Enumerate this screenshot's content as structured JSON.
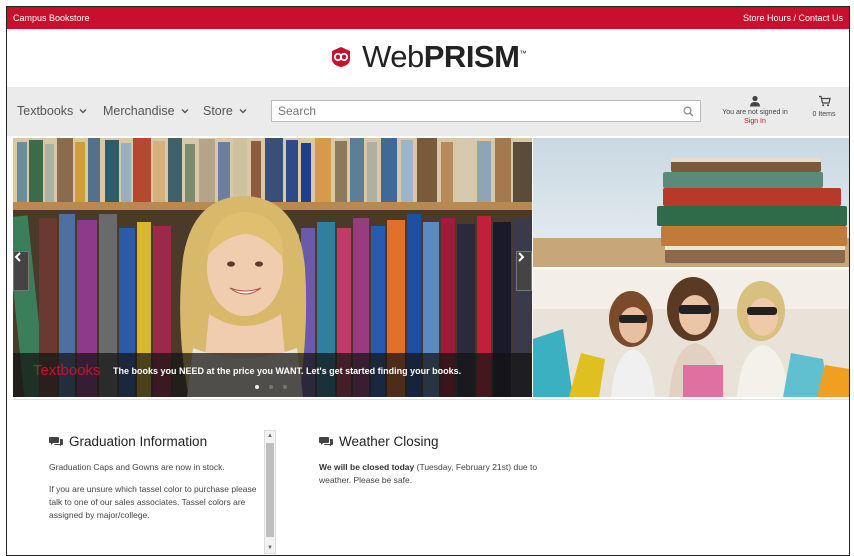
{
  "topbar": {
    "left_link": "Campus Bookstore",
    "right_link": "Store Hours / Contact Us",
    "bg_color": "#c8102e"
  },
  "brand": {
    "logo_web": "Web",
    "logo_prism": "PRISM",
    "trademark": "™",
    "icon": "prism-logo-icon"
  },
  "nav": {
    "items": [
      {
        "label": "Textbooks",
        "icon": "chevron-down-icon"
      },
      {
        "label": "Merchandise",
        "icon": "chevron-down-icon"
      },
      {
        "label": "Store",
        "icon": "chevron-down-icon"
      }
    ],
    "search_placeholder": "Search",
    "account_status": "You are not signed in",
    "sign_in": "Sign In",
    "cart_count": "0 Items"
  },
  "hero": {
    "title": "Textbooks",
    "text": "The books you NEED at the price you WANT. Let's get started finding your books.",
    "slide_count": 3,
    "active_slide": 1
  },
  "news": [
    {
      "title": "Graduation Information",
      "paragraphs": [
        "Graduation Caps and Gowns are now in stock.",
        "If you are unsure which tassel color to purchase please talk to one of our sales associates.  Tassel colors are assigned by major/college."
      ]
    },
    {
      "title": "Weather Closing",
      "bold": "We will be closed today",
      "text": " (Tuesday, February 21st) due to weather. Please be safe."
    }
  ],
  "colors": {
    "accent": "#c8102e",
    "navbar_bg": "#ebebeb"
  }
}
